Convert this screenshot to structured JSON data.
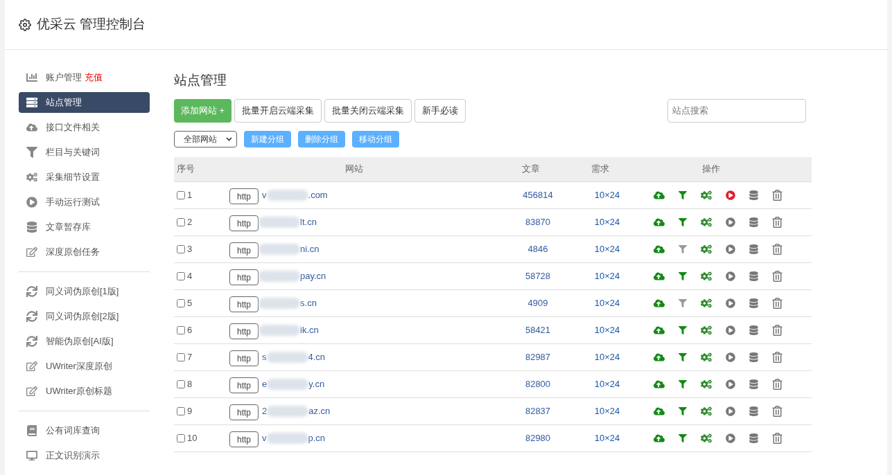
{
  "header": {
    "title": "优采云 管理控制台"
  },
  "sidebar": {
    "groups": [
      [
        {
          "label": "账户管理",
          "badge": "充值",
          "selected": false
        },
        {
          "label": "站点管理",
          "selected": true
        },
        {
          "label": "接口文件相关",
          "selected": false
        },
        {
          "label": "栏目与关键词",
          "selected": false
        },
        {
          "label": "采集细节设置",
          "selected": false
        },
        {
          "label": "手动运行测试",
          "selected": false
        },
        {
          "label": "文章暂存库",
          "selected": false
        },
        {
          "label": "深度原创任务",
          "selected": false
        }
      ],
      [
        {
          "label": "同义词伪原创[1版]",
          "selected": false
        },
        {
          "label": "同义词伪原创[2版]",
          "selected": false
        },
        {
          "label": "智能伪原创[AI版]",
          "selected": false
        },
        {
          "label": "UWriter深度原创",
          "selected": false
        },
        {
          "label": "UWriter原创标题",
          "selected": false
        }
      ],
      [
        {
          "label": "公有词库查询",
          "selected": false
        },
        {
          "label": "正文识别演示",
          "selected": false
        }
      ]
    ]
  },
  "page_title": "站点管理",
  "toolbar": {
    "add_button": "添加网站 +",
    "buttons": [
      "批量开启云端采集",
      "批量关闭云端采集",
      "新手必读"
    ],
    "search": {
      "placeholder": "站点搜索"
    }
  },
  "group_bar": {
    "select": "全部网站",
    "buttons": [
      "新建分组",
      "删除分组",
      "移动分组"
    ]
  },
  "table": {
    "columns": [
      "序号",
      "网站",
      "文章",
      "需求",
      "操作"
    ],
    "rows": [
      {
        "index": "1",
        "checked": false,
        "scheme": "http",
        "site_prefix": "v",
        "site_suffix": ".com",
        "articles": "456814",
        "demand": "10×24",
        "filter_on": true,
        "running": true
      },
      {
        "index": "2",
        "checked": false,
        "scheme": "http",
        "site_suffix": "lt.cn",
        "articles": "83870",
        "demand": "10×24",
        "filter_on": true,
        "running": false
      },
      {
        "index": "3",
        "checked": false,
        "scheme": "http",
        "site_suffix": "ni.cn",
        "articles": "4846",
        "demand": "10×24",
        "filter_on": false,
        "running": false
      },
      {
        "index": "4",
        "checked": false,
        "scheme": "http",
        "site_suffix": "pay.cn",
        "articles": "58728",
        "demand": "10×24",
        "filter_on": true,
        "running": false
      },
      {
        "index": "5",
        "checked": false,
        "scheme": "http",
        "site_suffix": "s.cn",
        "articles": "4909",
        "demand": "10×24",
        "filter_on": false,
        "running": false
      },
      {
        "index": "6",
        "checked": false,
        "scheme": "http",
        "site_suffix": "ik.cn",
        "articles": "58421",
        "demand": "10×24",
        "filter_on": true,
        "running": false
      },
      {
        "index": "7",
        "checked": false,
        "scheme": "http",
        "site_prefix": "s",
        "site_suffix": "4.cn",
        "articles": "82987",
        "demand": "10×24",
        "filter_on": true,
        "running": false
      },
      {
        "index": "8",
        "checked": false,
        "scheme": "http",
        "site_prefix": "e",
        "site_suffix": "y.cn",
        "articles": "82800",
        "demand": "10×24",
        "filter_on": true,
        "running": false
      },
      {
        "index": "9",
        "checked": false,
        "scheme": "http",
        "site_prefix": "2",
        "site_suffix": "az.cn",
        "articles": "82837",
        "demand": "10×24",
        "filter_on": true,
        "running": false
      },
      {
        "index": "10",
        "checked": false,
        "scheme": "http",
        "site_prefix": "v",
        "site_suffix": "p.cn",
        "articles": "82980",
        "demand": "10×24",
        "filter_on": true,
        "running": false
      }
    ]
  }
}
